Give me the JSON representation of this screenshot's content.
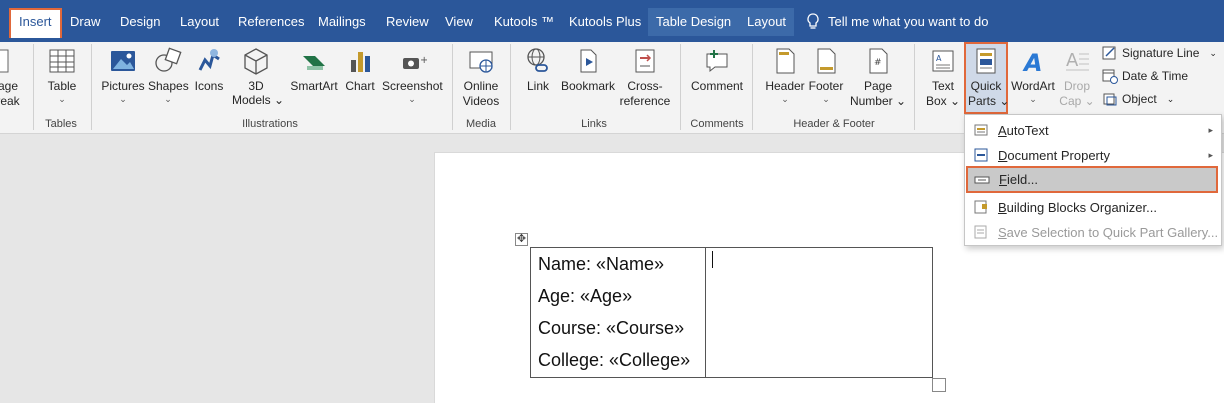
{
  "tabs": [
    {
      "label": "Insert",
      "active": true
    },
    {
      "label": "Draw"
    },
    {
      "label": "Design"
    },
    {
      "label": "Layout"
    },
    {
      "label": "References"
    },
    {
      "label": "Mailings"
    },
    {
      "label": "Review"
    },
    {
      "label": "View"
    },
    {
      "label": "Kutools ™"
    },
    {
      "label": "Kutools Plus"
    },
    {
      "label": "Table Design",
      "contextual": true
    },
    {
      "label": "Layout",
      "contextual": true
    }
  ],
  "tell_me": "Tell me what you want to do",
  "ribbon": {
    "pages": {
      "line1": "age",
      "line2": "reak"
    },
    "table": {
      "label": "Table",
      "group": "Tables"
    },
    "illustrations": {
      "group": "Illustrations",
      "pictures": "Pictures",
      "shapes": "Shapes",
      "icons": "Icons",
      "models_line1": "3D",
      "models_line2": "Models",
      "smartart": "SmartArt",
      "chart": "Chart",
      "screenshot": "Screenshot"
    },
    "media": {
      "group": "Media",
      "line1": "Online",
      "line2": "Videos"
    },
    "links": {
      "group": "Links",
      "link": "Link",
      "bookmark": "Bookmark",
      "crossref_line1": "Cross-",
      "crossref_line2": "reference"
    },
    "comments": {
      "group": "Comments",
      "comment": "Comment"
    },
    "header_footer": {
      "group": "Header & Footer",
      "header": "Header",
      "footer": "Footer",
      "page_line1": "Page",
      "page_line2": "Number"
    },
    "text": {
      "textbox_line1": "Text",
      "textbox_line2": "Box",
      "quickparts_line1": "Quick",
      "quickparts_line2": "Parts",
      "wordart": "WordArt",
      "dropcap_line1": "Drop",
      "dropcap_line2": "Cap",
      "signature_line": "Signature Line",
      "date_time": "Date & Time",
      "object": "Object"
    }
  },
  "quick_parts_menu": {
    "items": [
      {
        "label": "AutoText",
        "accel": "A",
        "rest": "utoText",
        "submenu": true
      },
      {
        "label": "Document Property",
        "accel": "D",
        "rest": "ocument Property",
        "submenu": true
      },
      {
        "label": "Field...",
        "accel": "F",
        "rest": "ield...",
        "selected": true
      },
      {
        "label": "Building Blocks Organizer...",
        "accel": "B",
        "rest": "uilding Blocks Organizer..."
      },
      {
        "label": "Save Selection to Quick Part Gallery...",
        "accel": "S",
        "rest": "ave Selection to Quick Part Gallery...",
        "disabled": true
      }
    ]
  },
  "document": {
    "table_lines": [
      "Name: «Name»",
      "Age: «Age»",
      "Course: «Course»",
      "College: «College»"
    ]
  },
  "colors": {
    "tab_bar": "#2b579a",
    "highlight": "#e0683b",
    "ribbon": "#f3f3f3"
  }
}
